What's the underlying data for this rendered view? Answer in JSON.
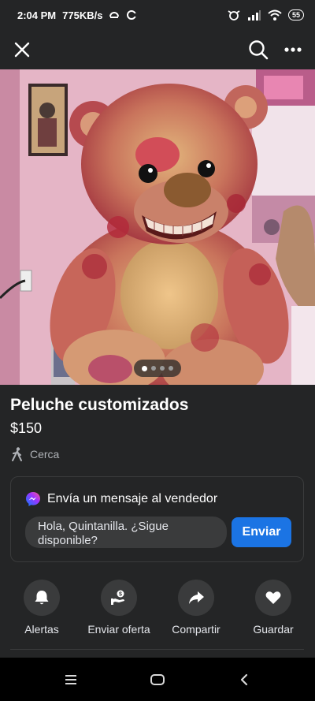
{
  "status_bar": {
    "time": "2:04 PM",
    "network_speed": "775KB/s",
    "battery": "55"
  },
  "top_nav": {
    "close_icon": "close-icon",
    "search_icon": "search-icon",
    "more_icon": "more-icon"
  },
  "listing": {
    "photo_count": 4,
    "active_photo": 1,
    "title": "Peluche customizados",
    "price": "$150",
    "location": "Cerca"
  },
  "message": {
    "heading": "Envía un mensaje al vendedor",
    "input_value": "Hola, Quintanilla. ¿Sigue disponible?",
    "send_label": "Enviar"
  },
  "actions": [
    {
      "label": "Alertas",
      "icon": "bell-icon"
    },
    {
      "label": "Enviar oferta",
      "icon": "offer-icon"
    },
    {
      "label": "Compartir",
      "icon": "share-icon"
    },
    {
      "label": "Guardar",
      "icon": "heart-icon"
    }
  ],
  "colors": {
    "background": "#242526",
    "accent": "#1b74e4",
    "surface": "#3a3b3c"
  }
}
